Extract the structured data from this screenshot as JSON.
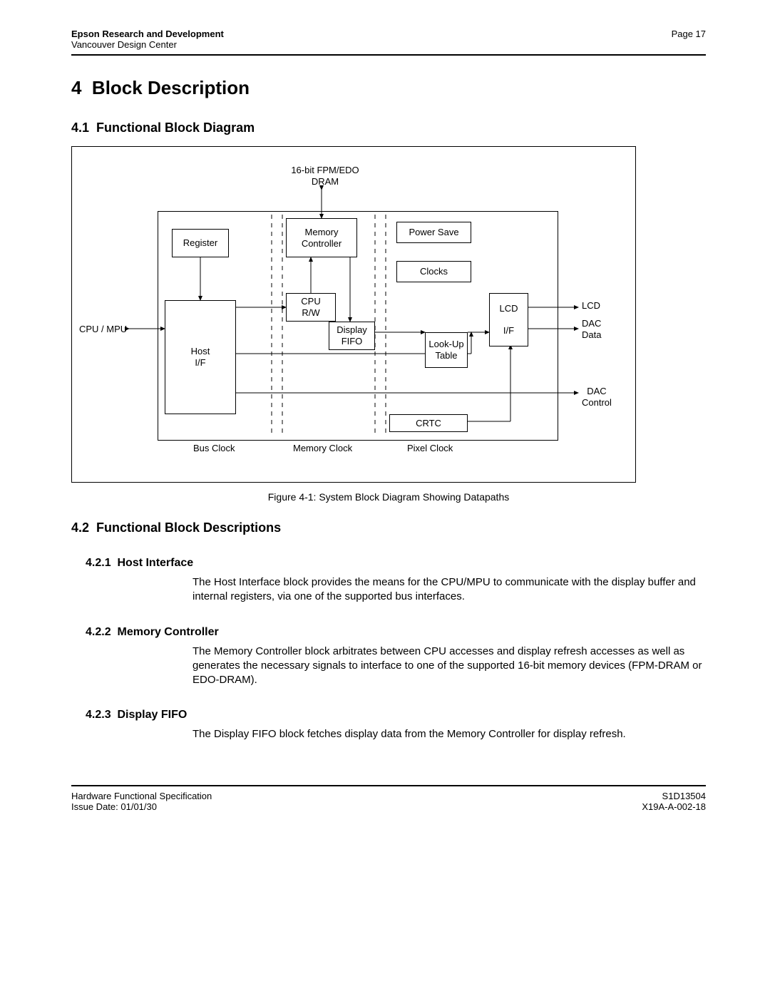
{
  "header": {
    "org": "Epson Research and Development",
    "dept": "Vancouver Design Center",
    "page_label": "Page 17"
  },
  "section": {
    "num": "4",
    "title": "Block Description"
  },
  "sub1": {
    "num": "4.1",
    "title": "Functional Block Diagram"
  },
  "diagram": {
    "top_label": "16-bit FPM/EDO\nDRAM",
    "cpu_mpu": "CPU / MPU",
    "register": "Register",
    "host_if": "Host\nI/F",
    "cpu_rw": "CPU\nR/W",
    "mem_ctrl": "Memory\nController",
    "display_fifo": "Display\nFIFO",
    "lut": "Look-Up\nTable",
    "power_save": "Power Save",
    "clocks": "Clocks",
    "lcd_if": "LCD\n\nI/F",
    "crtc": "CRTC",
    "out_lcd": "LCD",
    "out_dac_data": "DAC\nData",
    "out_dac_ctrl": "DAC\nControl",
    "bus_clock": "Bus Clock",
    "mem_clock": "Memory Clock",
    "pixel_clock": "Pixel Clock"
  },
  "figure_caption": "Figure 4-1: System Block Diagram Showing Datapaths",
  "sub2": {
    "num": "4.2",
    "title": "Functional Block Descriptions"
  },
  "s421": {
    "num": "4.2.1",
    "title": "Host Interface",
    "body": "The Host Interface block provides the means for the CPU/MPU to communicate with the display buffer and internal registers, via one of the supported bus interfaces."
  },
  "s422": {
    "num": "4.2.2",
    "title": "Memory Controller",
    "body": "The Memory Controller block arbitrates between CPU accesses and display refresh accesses as well as generates the necessary signals to interface to one of the supported 16-bit memory devices (FPM-DRAM or EDO-DRAM)."
  },
  "s423": {
    "num": "4.2.3",
    "title": "Display FIFO",
    "body": "The Display FIFO block fetches display data from the Memory Controller for display refresh."
  },
  "footer": {
    "doc_type": "Hardware Functional Specification",
    "issue": "Issue Date: 01/01/30",
    "part": "S1D13504",
    "docnum": "X19A-A-002-18"
  }
}
